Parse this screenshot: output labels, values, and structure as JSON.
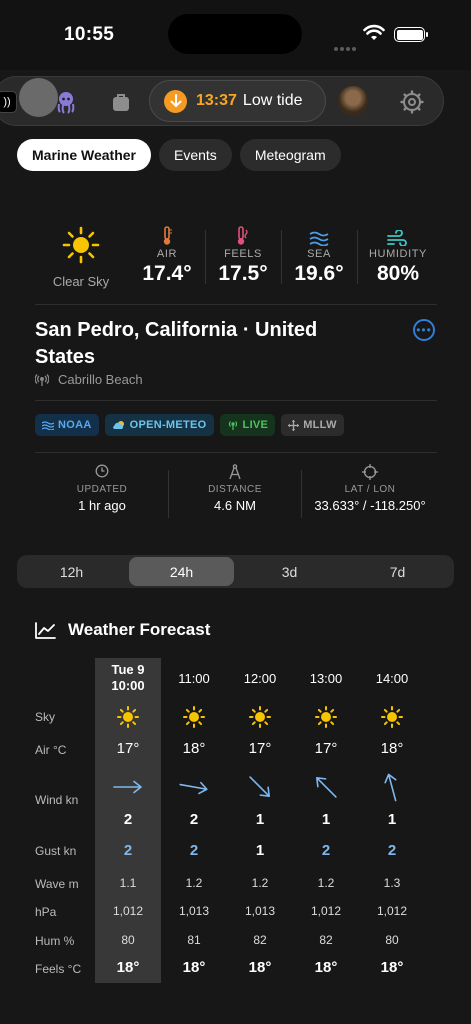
{
  "status_bar": {
    "time": "10:55"
  },
  "toolbar": {
    "tide_time": "13:37",
    "tide_label": "Low tide"
  },
  "tabs": [
    {
      "label": "Marine Weather",
      "active": true
    },
    {
      "label": "Events",
      "active": false
    },
    {
      "label": "Meteogram",
      "active": false
    }
  ],
  "current": {
    "sky_label": "Clear Sky",
    "metrics": [
      {
        "label": "AIR",
        "value": "17.4°",
        "icon": "thermometer-icon",
        "color": "#e07a3a"
      },
      {
        "label": "FEELS",
        "value": "17.5°",
        "icon": "thermometer-icon",
        "color": "#e0507a"
      },
      {
        "label": "SEA",
        "value": "19.6°",
        "icon": "waves-icon",
        "color": "#4a9eea"
      },
      {
        "label": "HUMIDITY",
        "value": "80%",
        "icon": "humidity-icon",
        "color": "#3ec6c6"
      }
    ]
  },
  "location": {
    "title": "San Pedro, California · United States",
    "station": "Cabrillo Beach"
  },
  "sources": [
    {
      "label": "NOAA",
      "icon": "waves-icon"
    },
    {
      "label": "OPEN-METEO",
      "icon": "cloud-sun-icon"
    },
    {
      "label": "LIVE",
      "icon": "antenna-icon"
    },
    {
      "label": "MLLW",
      "icon": "move-icon"
    }
  ],
  "info": {
    "updated_label": "UPDATED",
    "updated_value": "1 hr ago",
    "distance_label": "DISTANCE",
    "distance_value": "4.6 NM",
    "latlon_label": "LAT / LON",
    "latlon_value": "33.633° / -118.250°"
  },
  "range": {
    "options": [
      "12h",
      "24h",
      "3d",
      "7d"
    ],
    "selected": "24h"
  },
  "forecast": {
    "title": "Weather Forecast",
    "row_labels": {
      "sky": "Sky",
      "air": "Air °C",
      "wind": "Wind kn",
      "gust": "Gust kn",
      "wave": "Wave m",
      "hpa": "hPa",
      "hum": "Hum %",
      "feels": "Feels °C"
    },
    "columns": [
      {
        "day": "Tue 9",
        "time": "10:00",
        "air": "17°",
        "wind_dir_deg": 90,
        "wind": "2",
        "gust": "2",
        "gust_highlight": true,
        "wave": "1.1",
        "hpa": "1,012",
        "hum": "80",
        "feels": "18°"
      },
      {
        "day": "",
        "time": "11:00",
        "air": "18°",
        "wind_dir_deg": 100,
        "wind": "2",
        "gust": "2",
        "gust_highlight": true,
        "wave": "1.2",
        "hpa": "1,013",
        "hum": "81",
        "feels": "18°"
      },
      {
        "day": "",
        "time": "12:00",
        "air": "17°",
        "wind_dir_deg": 135,
        "wind": "1",
        "gust": "1",
        "gust_highlight": false,
        "wave": "1.2",
        "hpa": "1,013",
        "hum": "82",
        "feels": "18°"
      },
      {
        "day": "",
        "time": "13:00",
        "air": "17°",
        "wind_dir_deg": 315,
        "wind": "1",
        "gust": "2",
        "gust_highlight": true,
        "wave": "1.2",
        "hpa": "1,012",
        "hum": "82",
        "feels": "18°"
      },
      {
        "day": "",
        "time": "14:00",
        "air": "18°",
        "wind_dir_deg": 345,
        "wind": "1",
        "gust": "2",
        "gust_highlight": true,
        "wave": "1.3",
        "hpa": "1,012",
        "hum": "80",
        "feels": "18°"
      }
    ]
  }
}
